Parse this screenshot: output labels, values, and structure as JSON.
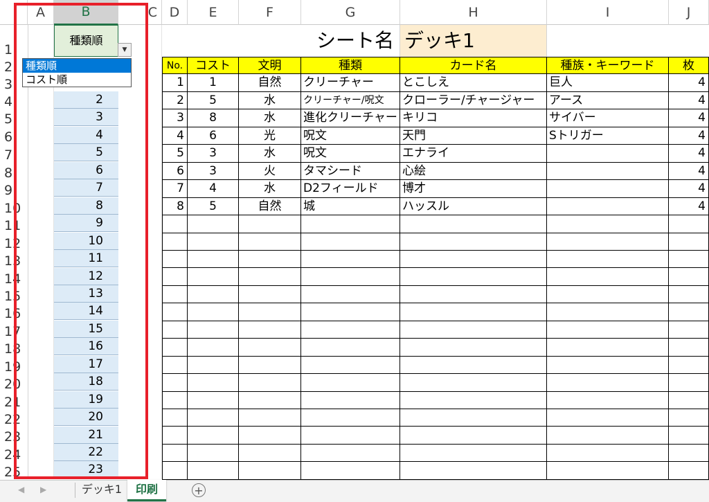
{
  "columns": [
    "A",
    "B",
    "C",
    "D",
    "E",
    "F",
    "G",
    "H",
    "I",
    "J"
  ],
  "row_numbers": [
    "1",
    "2",
    "3",
    "4",
    "5",
    "6",
    "7",
    "8",
    "9",
    "10",
    "11",
    "12",
    "13",
    "14",
    "15",
    "16",
    "17",
    "18",
    "19",
    "20",
    "21",
    "22",
    "23",
    "24",
    "25"
  ],
  "sort_cell": "種類順",
  "dropdown": {
    "options": [
      "種類順",
      "コスト順"
    ],
    "selected": "種類順"
  },
  "b_values": [
    "2",
    "3",
    "4",
    "5",
    "6",
    "7",
    "8",
    "9",
    "10",
    "11",
    "12",
    "13",
    "14",
    "15",
    "16",
    "17",
    "18",
    "19",
    "20",
    "21",
    "22",
    "23"
  ],
  "sheet_label": "シート名",
  "sheet_name": "デッキ1",
  "table": {
    "headers": [
      "No.",
      "コスト",
      "文明",
      "種類",
      "カード名",
      "種族・キーワード",
      "枚"
    ],
    "rows": [
      [
        "1",
        "1",
        "自然",
        "クリーチャー",
        "とこしえ",
        "巨人",
        "4"
      ],
      [
        "2",
        "5",
        "水",
        "クリーチャー/呪文",
        "クローラー/チャージャー",
        "アース",
        "4"
      ],
      [
        "3",
        "8",
        "水",
        "進化クリーチャー",
        "キリコ",
        "サイバー",
        "4"
      ],
      [
        "4",
        "6",
        "光",
        "呪文",
        "天門",
        "Sトリガー",
        "4"
      ],
      [
        "5",
        "3",
        "水",
        "呪文",
        "エナライ",
        "",
        "4"
      ],
      [
        "6",
        "3",
        "火",
        "タマシード",
        "心絵",
        "",
        "4"
      ],
      [
        "7",
        "4",
        "水",
        "D2フィールド",
        "博才",
        "",
        "4"
      ],
      [
        "8",
        "5",
        "自然",
        "城",
        "ハッスル",
        "",
        "4"
      ]
    ]
  },
  "sheet_tabs": [
    "デッキ1",
    "印刷"
  ],
  "active_tab": "印刷",
  "colors": {
    "highlight_red": "#e8202a",
    "header_yellow": "#ffff00",
    "sheet_name_bg": "#fdedd0",
    "selected_cell_bg": "#e2efda",
    "accent_green": "#217346"
  }
}
